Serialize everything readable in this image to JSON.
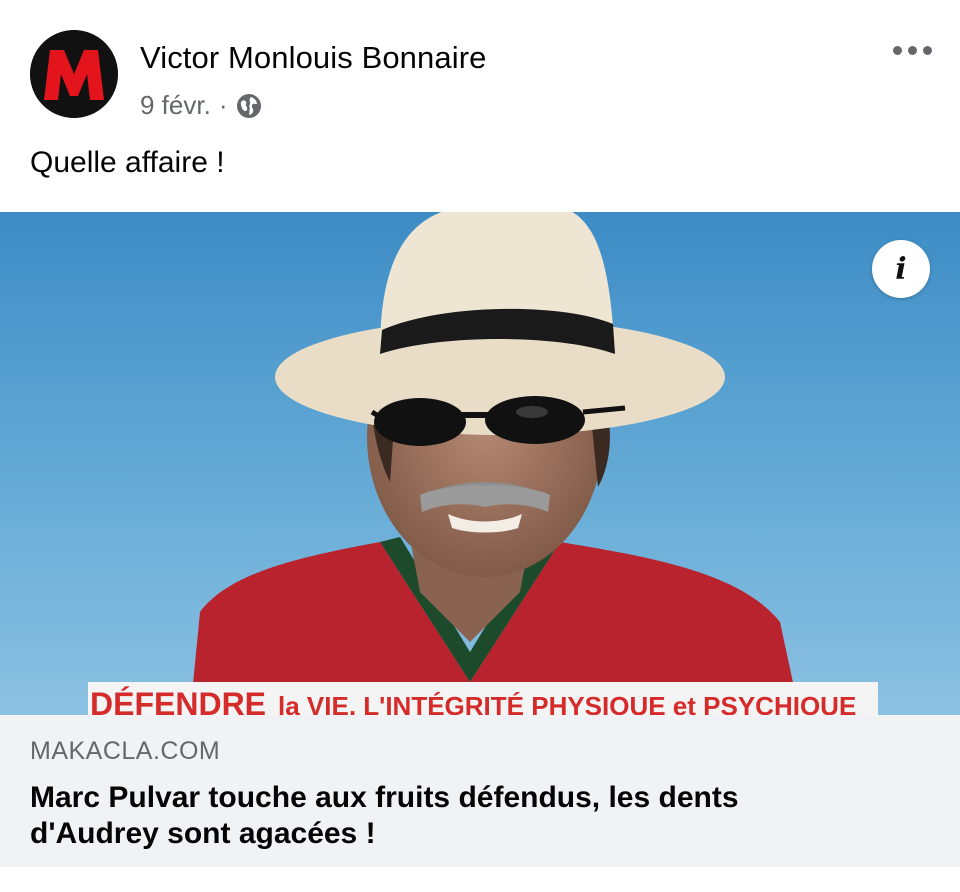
{
  "post": {
    "author": "Victor Monlouis Bonnaire",
    "date": "9 févr.",
    "separator": "·",
    "caption": "Quelle affaire !",
    "avatar_letter": "M"
  },
  "link_preview": {
    "banner_text_bold": "DÉFENDRE",
    "banner_text_rest": "la VIE, L'INTÉGRITÉ PHYSIQUE et PSYCHIQUE",
    "info_label": "i",
    "domain": "MAKACLA.COM",
    "headline": "Marc Pulvar touche aux fruits défendus, les dents d'Audrey sont agacées !"
  },
  "icons": {
    "more": "more-options-icon",
    "audience": "globe-icon",
    "info": "info-icon"
  },
  "colors": {
    "avatar_bg": "#111111",
    "avatar_letter": "#e3141c",
    "sky": "#5aa0d0",
    "jacket": "#b8232e",
    "banner_red": "#d52b2b",
    "muted": "#65676b",
    "link_bg": "#f0f2f5"
  }
}
